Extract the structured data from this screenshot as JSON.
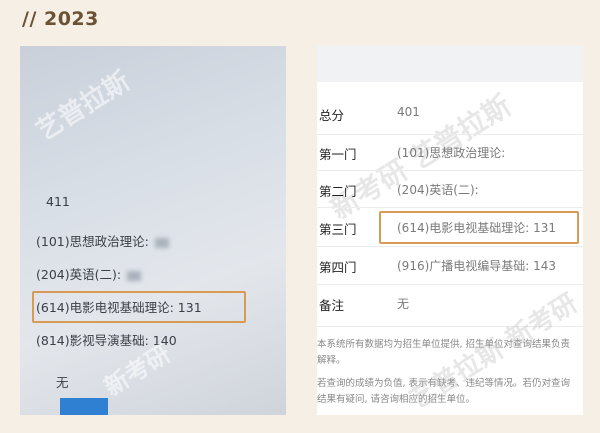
{
  "header": {
    "title": "// 2023"
  },
  "left_photo": {
    "total_value": "411",
    "rows": [
      {
        "label": "(101)思想政治理论:"
      },
      {
        "label": "(204)英语(二):"
      },
      {
        "label": "(614)电影电视基础理论: 131"
      },
      {
        "label": "(814)影视导演基础: 140"
      }
    ],
    "remark": "无",
    "watermark_top": "艺普拉斯",
    "watermark_bottom": "新考研"
  },
  "right_shot": {
    "rows": [
      {
        "label": "总分",
        "value": "401"
      },
      {
        "label": "第一门",
        "value": "(101)思想政治理论:"
      },
      {
        "label": "第二门",
        "value": "(204)英语(二):"
      },
      {
        "label": "第三门",
        "value": "(614)电影电视基础理论: 131"
      },
      {
        "label": "第四门",
        "value": "(916)广播电视编导基础: 143"
      },
      {
        "label": "备注",
        "value": "无"
      }
    ],
    "note1": "本系统所有数据均为招生单位提供, 招生单位对查询结果负责解释。",
    "note2": "若查询的成绩为负值, 表示有缺考、违纪等情况。若仍对查询结果有疑问, 请咨询相应的招生单位。",
    "watermark_1": "新考研  艺普拉斯",
    "watermark_2": "艺普拉斯  新考研"
  }
}
